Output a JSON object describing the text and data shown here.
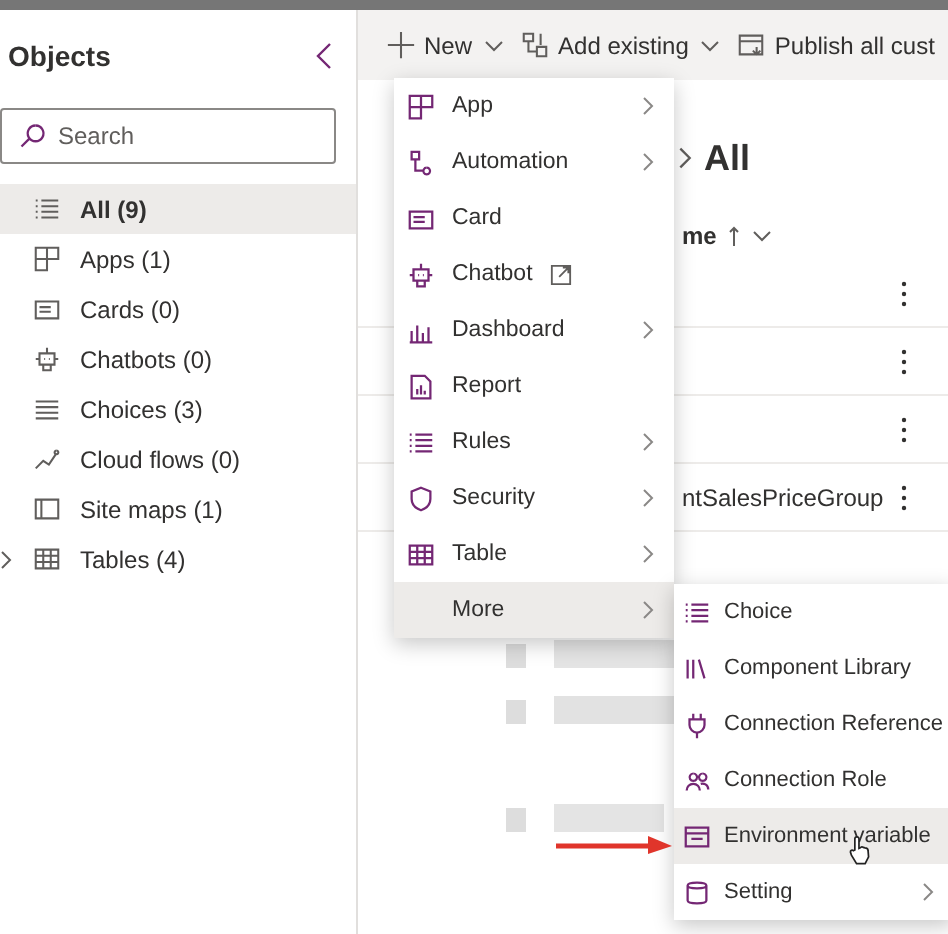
{
  "sidebar": {
    "title": "Objects",
    "search": {
      "placeholder": "Search"
    },
    "items": [
      {
        "label": "All (9)",
        "selected": true,
        "expandable": false
      },
      {
        "label": "Apps (1)",
        "selected": false,
        "expandable": false
      },
      {
        "label": "Cards (0)",
        "selected": false,
        "expandable": false
      },
      {
        "label": "Chatbots (0)",
        "selected": false,
        "expandable": false
      },
      {
        "label": "Choices (3)",
        "selected": false,
        "expandable": false
      },
      {
        "label": "Cloud flows (0)",
        "selected": false,
        "expandable": false
      },
      {
        "label": "Site maps (1)",
        "selected": false,
        "expandable": false
      },
      {
        "label": "Tables (4)",
        "selected": false,
        "expandable": true
      }
    ]
  },
  "toolbar": {
    "buttons": [
      {
        "label": "New",
        "dropdown": true
      },
      {
        "label": "Add existing",
        "dropdown": true
      },
      {
        "label": "Publish all cust",
        "dropdown": false
      }
    ]
  },
  "main": {
    "heading": "All",
    "column_header": "me",
    "rows": [
      {
        "kind": "blank"
      },
      {
        "kind": "blank"
      },
      {
        "kind": "blank"
      },
      {
        "kind": "named",
        "name": "ntSalesPriceGroup"
      }
    ]
  },
  "new_menu": {
    "items": [
      {
        "label": "App",
        "submenu": true,
        "external": false,
        "selected": false
      },
      {
        "label": "Automation",
        "submenu": true,
        "external": false,
        "selected": false
      },
      {
        "label": "Card",
        "submenu": false,
        "external": false,
        "selected": false
      },
      {
        "label": "Chatbot",
        "submenu": false,
        "external": true,
        "selected": false
      },
      {
        "label": "Dashboard",
        "submenu": true,
        "external": false,
        "selected": false
      },
      {
        "label": "Report",
        "submenu": false,
        "external": false,
        "selected": false
      },
      {
        "label": "Rules",
        "submenu": true,
        "external": false,
        "selected": false
      },
      {
        "label": "Security",
        "submenu": true,
        "external": false,
        "selected": false
      },
      {
        "label": "Table",
        "submenu": true,
        "external": false,
        "selected": false
      },
      {
        "label": "More",
        "submenu": true,
        "external": false,
        "selected": true
      }
    ]
  },
  "more_menu": {
    "items": [
      {
        "label": "Choice",
        "submenu": false,
        "selected": false
      },
      {
        "label": "Component Library",
        "submenu": false,
        "selected": false
      },
      {
        "label": "Connection Reference",
        "submenu": false,
        "selected": false
      },
      {
        "label": "Connection Role",
        "submenu": false,
        "selected": false
      },
      {
        "label": "Environment variable",
        "submenu": false,
        "selected": true
      },
      {
        "label": "Setting",
        "submenu": true,
        "selected": false
      }
    ]
  }
}
